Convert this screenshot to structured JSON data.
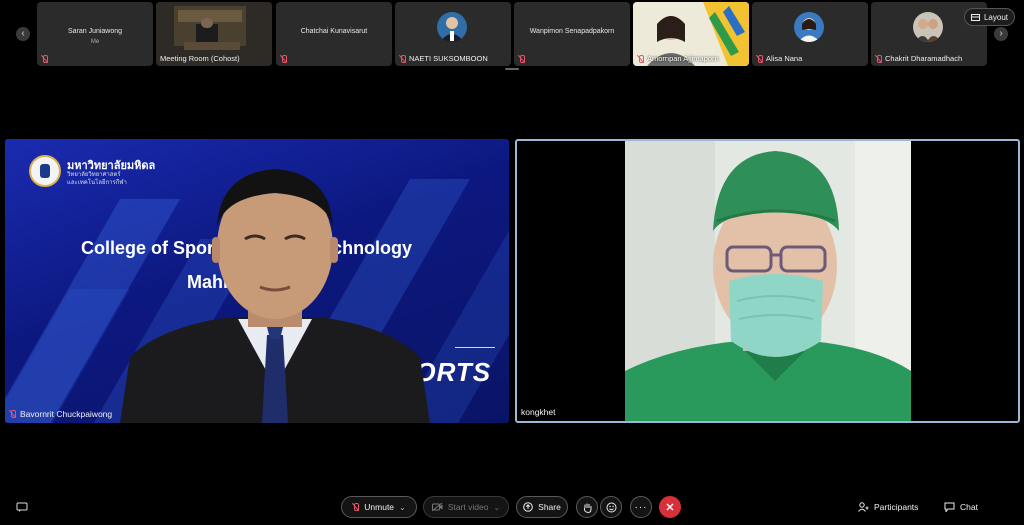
{
  "strip": {
    "prev_icon": "chevron-left-icon",
    "next_icon": "chevron-right-icon",
    "tiles": [
      {
        "name": "Saran Juniawong",
        "sub": "Me",
        "label": "",
        "muted": true
      },
      {
        "name": "",
        "sub": "",
        "label": "Meeting Room (Cohost)",
        "muted": false
      },
      {
        "name": "Chatchai Kunavisarut",
        "sub": "",
        "label": "",
        "muted": true
      },
      {
        "name": "",
        "sub": "",
        "label": "NAETI SUKSOMBOON",
        "muted": true
      },
      {
        "name": "Wanpimon Senapadpakorn",
        "sub": "",
        "label": "",
        "muted": true
      },
      {
        "name": "",
        "sub": "",
        "label": "Amornpan Ajjimaporn",
        "muted": true
      },
      {
        "name": "",
        "sub": "",
        "label": "Alisa Nana",
        "muted": true
      },
      {
        "name": "",
        "sub": "",
        "label": "Chakrit Dharamadhach",
        "muted": true
      }
    ],
    "layout_label": "Layout"
  },
  "main": {
    "left": {
      "participant": "Bavornrit Chuckpaiwong",
      "slide": {
        "university": "มหาวิทยาลัยมหิดล",
        "faculty_line1": "วิทยาลัยวิทยาศาสตร์",
        "faculty_line2": "และเทคโนโลยีการกีฬา",
        "title_line1": "College of Sports",
        "title_line1_right": "echnology",
        "title_line2": "Mahid",
        "sports_text": "PORTS"
      }
    },
    "right": {
      "participant": "kongkhet"
    }
  },
  "toolbar": {
    "unmute_label": "Unmute",
    "start_video_label": "Start video",
    "share_label": "Share",
    "participants_label": "Participants",
    "chat_label": "Chat"
  },
  "colors": {
    "muted_icon": "#e4566a",
    "end_call": "#d8303a",
    "active_speaker_border": "#9ab8d8",
    "slide_blue": "#0d1a7a"
  }
}
